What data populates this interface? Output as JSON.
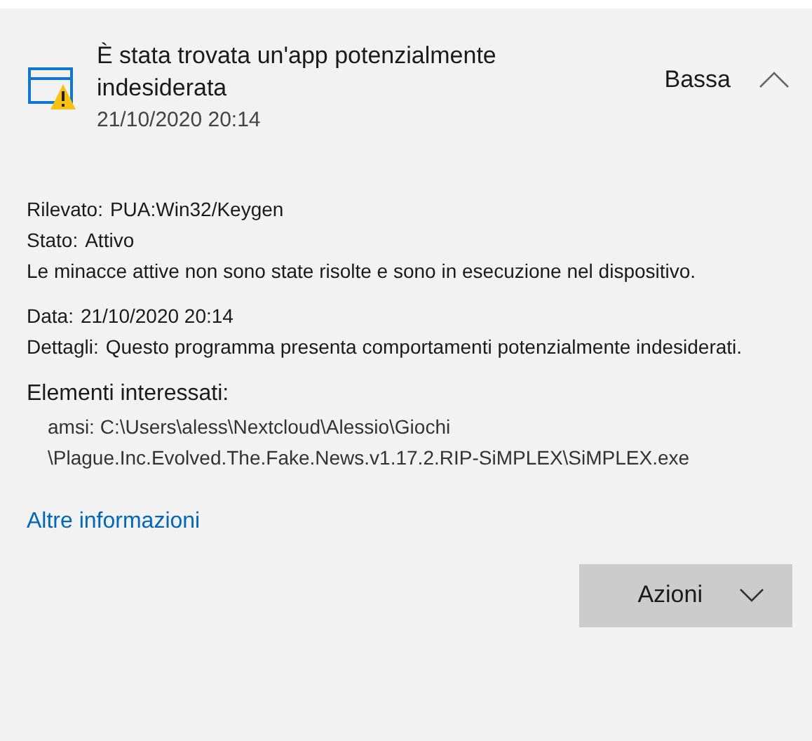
{
  "header": {
    "title": "È stata trovata un'app potenzialmente indesiderata",
    "date": "21/10/2020 20:14",
    "severity": "Bassa",
    "expanded": true
  },
  "details": [
    {
      "label": "Rilevato:",
      "value": "PUA:Win32/Keygen"
    },
    {
      "label": "Stato:",
      "value": "Attivo"
    }
  ],
  "status_note": "Le minacce attive non sono state risolte e sono in esecuzione nel dispositivo.",
  "details2": [
    {
      "label": "Data:",
      "value": "21/10/2020 20:14"
    },
    {
      "label": "Dettagli:",
      "value": "Questo programma presenta comportamenti potenzialmente indesiderati."
    }
  ],
  "affected": {
    "heading": "Elementi interessati:",
    "path_lines": [
      "amsi: C:\\Users\\aless\\Nextcloud\\Alessio\\Giochi",
      "\\Plague.Inc.Evolved.The.Fake.News.v1.17.2.RIP-SiMPLEX\\SiMPLEX.exe"
    ]
  },
  "link": "Altre informazioni",
  "actions_button": "Azioni"
}
